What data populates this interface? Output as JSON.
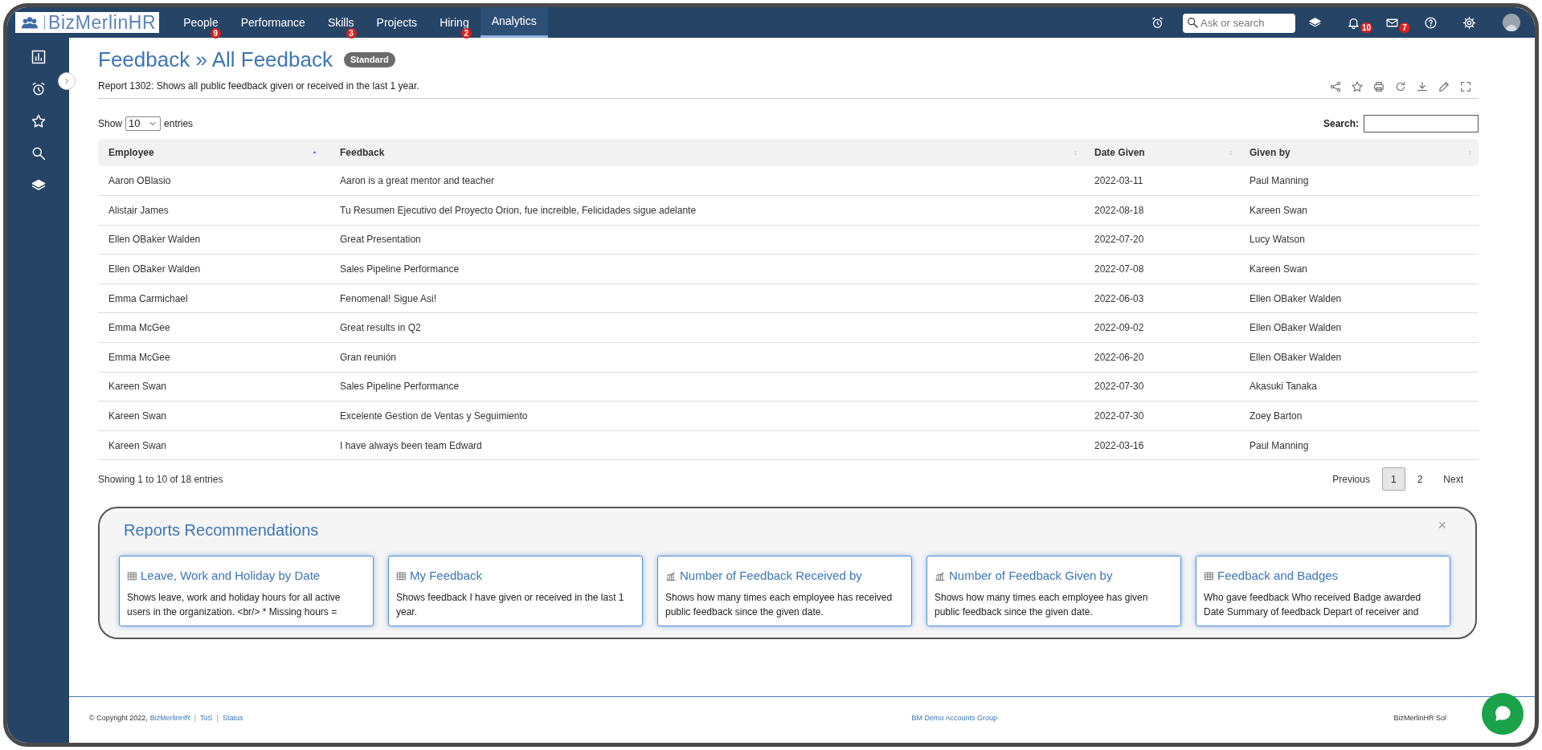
{
  "brand": {
    "name": "BizMerlinHR"
  },
  "nav": [
    {
      "label": "People",
      "badge": "9",
      "selected": false
    },
    {
      "label": "Performance",
      "selected": false
    },
    {
      "label": "Skills",
      "badge": "3",
      "selected": false
    },
    {
      "label": "Projects",
      "selected": false
    },
    {
      "label": "Hiring",
      "badge": "2",
      "selected": false
    },
    {
      "label": "Analytics",
      "selected": true
    }
  ],
  "search": {
    "placeholder": "Ask or search"
  },
  "notifications": {
    "badge": "10"
  },
  "messages": {
    "badge": "7"
  },
  "page": {
    "title": "Feedback » All Feedback",
    "tag": "Standard",
    "description": "Report  1302: Shows all public feedback given or received in the last 1 year."
  },
  "length": {
    "before": "Show",
    "value": "10",
    "after": "entries"
  },
  "filter": {
    "label": "Search:"
  },
  "table": {
    "columns": [
      {
        "label": "Employee",
        "sorted": true
      },
      {
        "label": "Feedback",
        "sorted": false
      },
      {
        "label": "Date Given",
        "sorted": false
      },
      {
        "label": "Given by",
        "sorted": false
      }
    ],
    "rows": [
      [
        "Aaron OBlasio",
        "Aaron is a great mentor and teacher",
        "2022-03-11",
        "Paul Manning"
      ],
      [
        "Alistair James",
        "Tu Resumen Ejecutivo del Proyecto Orion, fue increible, Felicidades sigue adelante",
        "2022-08-18",
        "Kareen Swan"
      ],
      [
        "Ellen OBaker Walden",
        "Great Presentation",
        "2022-07-20",
        "Lucy Watson"
      ],
      [
        "Ellen OBaker Walden",
        "Sales Pipeline Performance",
        "2022-07-08",
        "Kareen Swan"
      ],
      [
        "Emma Carmichael",
        "Fenomenal! Sigue Asi!",
        "2022-06-03",
        "Ellen OBaker Walden"
      ],
      [
        "Emma McGee",
        "Great results in Q2",
        "2022-09-02",
        "Ellen OBaker Walden"
      ],
      [
        "Emma McGee",
        "Gran reunión",
        "2022-06-20",
        "Ellen OBaker Walden"
      ],
      [
        "Kareen Swan",
        "Sales Pipeline Performance",
        "2022-07-30",
        "Akasuki Tanaka"
      ],
      [
        "Kareen Swan",
        "Excelente Gestion de Ventas y Seguimiento",
        "2022-07-30",
        "Zoey Barton"
      ],
      [
        "Kareen Swan",
        "I have always been team Edward",
        "2022-03-16",
        "Paul Manning"
      ]
    ]
  },
  "info": "Showing 1 to 10 of 18 entries",
  "pagination": [
    {
      "label": "Previous",
      "selected": false
    },
    {
      "label": "1",
      "selected": true
    },
    {
      "label": "2",
      "selected": false
    },
    {
      "label": "Next",
      "selected": false
    }
  ],
  "recommendations": {
    "title": "Reports Recommendations",
    "close": "×",
    "cards": [
      {
        "kind": "table",
        "title": "Leave, Work and Holiday by Date",
        "text": "Shows leave, work and holiday hours for all active users in the organization. <br/> * Missing hours ="
      },
      {
        "kind": "table",
        "title": "My Feedback",
        "text": "Shows feedback I have given or received in the last 1 year."
      },
      {
        "kind": "chart",
        "title": "Number of Feedback Received by",
        "text": "Shows how many times each employee has received public feedback since the given date."
      },
      {
        "kind": "chart",
        "title": "Number of Feedback Given by",
        "text": "Shows how many times each employee has given public feedback since the given date."
      },
      {
        "kind": "table",
        "title": "Feedback and Badges",
        "text": "Who gave feedback Who received Badge awarded Date Summary of feedback Depart of receiver and"
      }
    ]
  },
  "footer": {
    "copyright": "© Copyright 2022,",
    "company": "BizMerlinHR",
    "separator": "|",
    "links": [
      "ToS",
      "Status"
    ],
    "center": "BM Demo Accounts Group",
    "right": "BizMerlinHR Sol"
  }
}
